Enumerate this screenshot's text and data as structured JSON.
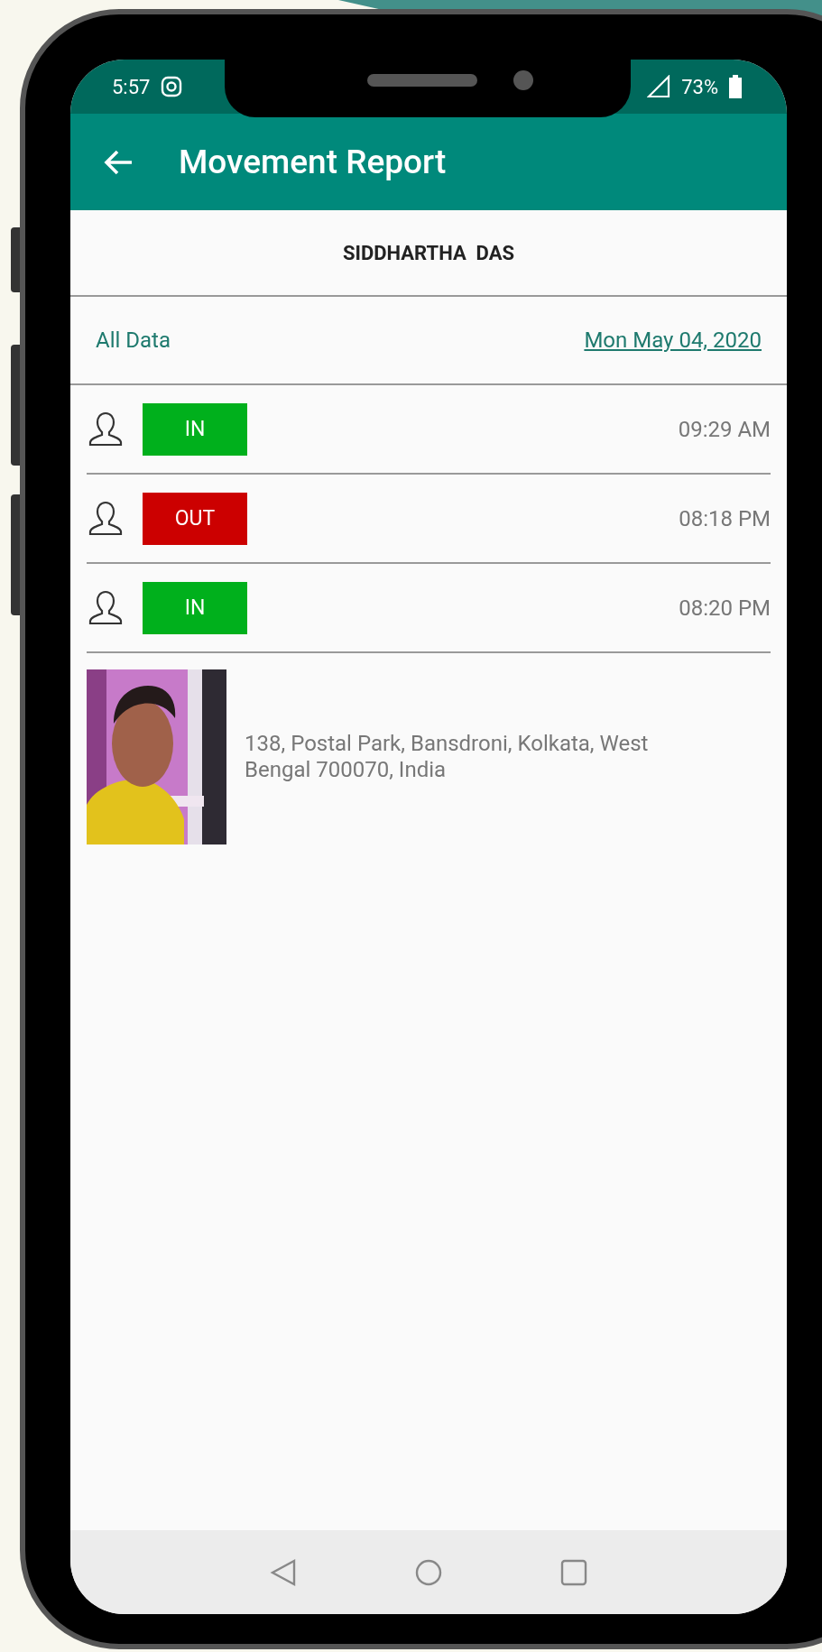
{
  "status_bar": {
    "time": "5:57",
    "battery": "73%"
  },
  "app_bar": {
    "title": "Movement Report"
  },
  "employee": {
    "name": "SIDDHARTHA  DAS"
  },
  "filter": {
    "all_label": "All Data",
    "date": "Mon May 04, 2020"
  },
  "entries": [
    {
      "kind": "in",
      "status": "IN",
      "time": "09:29 AM"
    },
    {
      "kind": "out",
      "status": "OUT",
      "time": "08:18 PM"
    },
    {
      "kind": "in",
      "status": "IN",
      "time": "08:20 PM"
    }
  ],
  "location": {
    "address": "138, Postal Park, Bansdroni, Kolkata, West Bengal 700070, India"
  }
}
